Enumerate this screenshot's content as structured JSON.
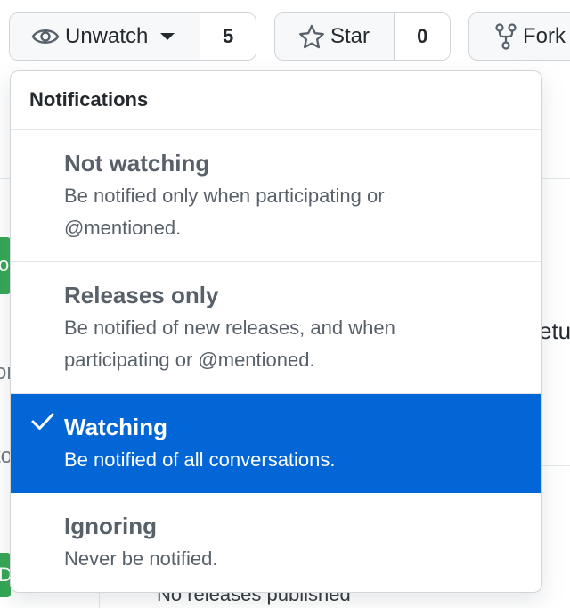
{
  "actions": {
    "watch": {
      "label": "Unwatch",
      "count": "5",
      "icon": "eye-icon"
    },
    "star": {
      "label": "Star",
      "count": "0",
      "icon": "star-icon"
    },
    "fork": {
      "label": "Fork",
      "icon": "repo-forked-icon"
    }
  },
  "notifications": {
    "header": "Notifications",
    "options": [
      {
        "title": "Not watching",
        "description": "Be notified only when participating or @mentioned.",
        "selected": false
      },
      {
        "title": "Releases only",
        "description": "Be notified of new releases, and when participating or @mentioned.",
        "selected": false
      },
      {
        "title": "Watching",
        "description": "Be notified of all conversations.",
        "selected": true
      },
      {
        "title": "Ignoring",
        "description": "Never be notified.",
        "selected": false
      }
    ]
  },
  "background": {
    "bottom_text": "No releases published",
    "fragment_right": "etu",
    "fragment_left_1": "or",
    "fragment_left_2": "to",
    "fragment_left_3": "D",
    "fragment_left_4": "o"
  },
  "colors": {
    "selected_bg": "#0366d6",
    "primary_green": "#2ea44f"
  }
}
